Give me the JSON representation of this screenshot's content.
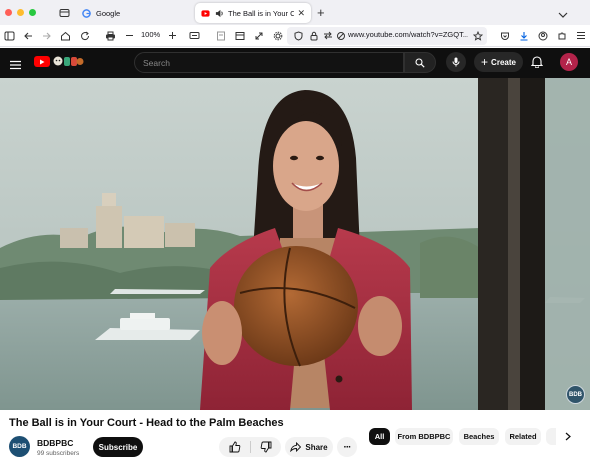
{
  "browser": {
    "tabs": [
      {
        "label": "Google",
        "favicon": "google-g-icon"
      },
      {
        "label": "The Ball is in Your Court - He",
        "favicon": "youtube-icon",
        "active": true
      }
    ],
    "zoom": "100%",
    "url": "www.youtube.com/watch?v=ZGQT..."
  },
  "youtube": {
    "search_placeholder": "Search",
    "create_label": "Create",
    "account_initial": "A",
    "brand_red": "#ff0000"
  },
  "video": {
    "title": "The Ball is in Your Court - Head to the Palm Beaches",
    "watermark": "BDB"
  },
  "channel": {
    "avatar_text": "BDB",
    "name": "BDBPBC",
    "subscribers": "99 subscribers",
    "subscribe_label": "Subscribe"
  },
  "actions": {
    "share_label": "Share"
  },
  "chips": [
    "All",
    "From BDBPBC",
    "Beaches",
    "Related"
  ]
}
